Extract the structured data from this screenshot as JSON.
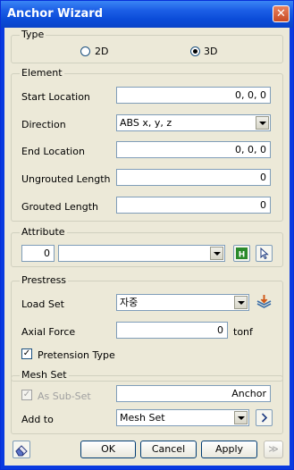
{
  "window": {
    "title": "Anchor Wizard"
  },
  "type_group": {
    "legend": "Type",
    "option_2d": "2D",
    "option_3d": "3D",
    "selected": "3D"
  },
  "element_group": {
    "legend": "Element",
    "start_location": {
      "label": "Start Location",
      "value": "0, 0, 0"
    },
    "direction": {
      "label": "Direction",
      "value": "ABS x, y, z"
    },
    "end_location": {
      "label": "End Location",
      "value": "0, 0, 0"
    },
    "ungrouted_length": {
      "label": "Ungrouted Length",
      "value": "0"
    },
    "grouted_length": {
      "label": "Grouted Length",
      "value": "0"
    }
  },
  "attribute_group": {
    "legend": "Attribute",
    "id_value": "0",
    "name_value": ""
  },
  "prestress_group": {
    "legend": "Prestress",
    "load_set": {
      "label": "Load Set",
      "value": "자중"
    },
    "axial_force": {
      "label": "Axial Force",
      "value": "0",
      "unit": "tonf"
    },
    "pretension": {
      "label": "Pretension Type",
      "checked": true
    }
  },
  "mesh_group": {
    "legend": "Mesh Set",
    "as_sub_set": {
      "label": "As Sub-Set",
      "checked": true,
      "disabled": true
    },
    "name_value": "Anchor",
    "add_to": {
      "label": "Add to",
      "value": "Mesh Set"
    }
  },
  "buttons": {
    "ok": "OK",
    "cancel": "Cancel",
    "apply": "Apply",
    "more": "≫"
  },
  "icons": {
    "close": "close-icon",
    "eraser": "eraser-icon",
    "chart_color": "#2a8a2a"
  }
}
